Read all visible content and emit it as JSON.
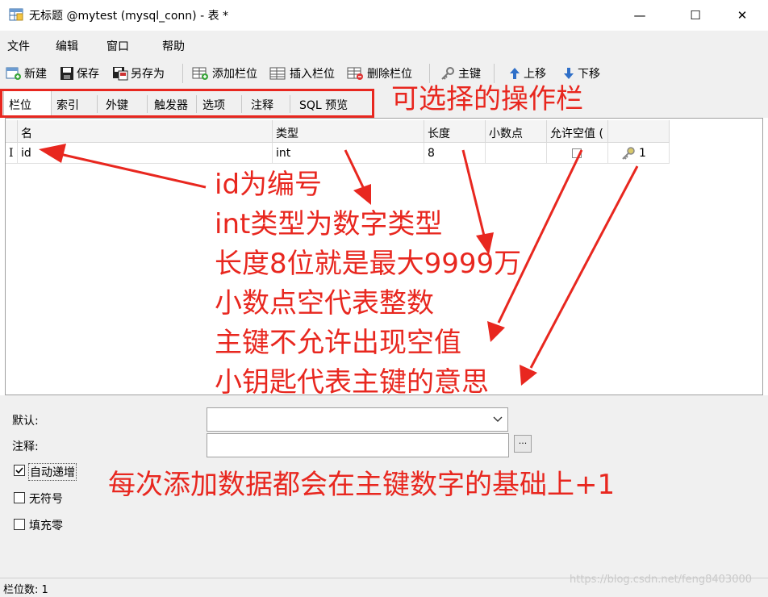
{
  "window": {
    "title": "无标题 @mytest (mysql_conn) - 表 *",
    "minimize": "—",
    "maximize": "☐",
    "close": "✕"
  },
  "menu": [
    "文件",
    "编辑",
    "窗口",
    "帮助"
  ],
  "toolbar": {
    "new": "新建",
    "save": "保存",
    "save_as": "另存为",
    "add_column": "添加栏位",
    "insert_column": "插入栏位",
    "delete_column": "删除栏位",
    "primary_key": "主键",
    "move_up": "上移",
    "move_down": "下移"
  },
  "tabs": [
    "栏位",
    "索引",
    "外键",
    "触发器",
    "选项",
    "注释",
    "SQL 预览"
  ],
  "grid": {
    "headers": [
      "名",
      "类型",
      "长度",
      "小数点",
      "允许空值 ("
    ],
    "rows": [
      {
        "marker": "I",
        "name": "id",
        "type": "int",
        "length": "8",
        "decimals": "",
        "nullable": false,
        "key": "1"
      }
    ]
  },
  "annotations": {
    "tabs_note": "可选择的操作栏",
    "lines": [
      "id为编号",
      "int类型为数字类型",
      "长度8位就是最大9999万",
      "小数点空代表整数",
      "主键不允许出现空值",
      "小钥匙代表主键的意思"
    ],
    "auto_increment_note": "每次添加数据都会在主键数字的基础上+1"
  },
  "properties": {
    "default_label": "默认:",
    "default_value": "",
    "comment_label": "注释:",
    "comment_value": "",
    "ellipsis": "...",
    "auto_increment": {
      "label": "自动递增",
      "checked": true
    },
    "unsigned": {
      "label": "无符号",
      "checked": false
    },
    "zerofill": {
      "label": "填充零",
      "checked": false
    }
  },
  "status": {
    "field_count": "栏位数: 1"
  },
  "watermark": "https://blog.csdn.net/feng8403000",
  "colors": {
    "annotation_red": "#e8271f"
  }
}
